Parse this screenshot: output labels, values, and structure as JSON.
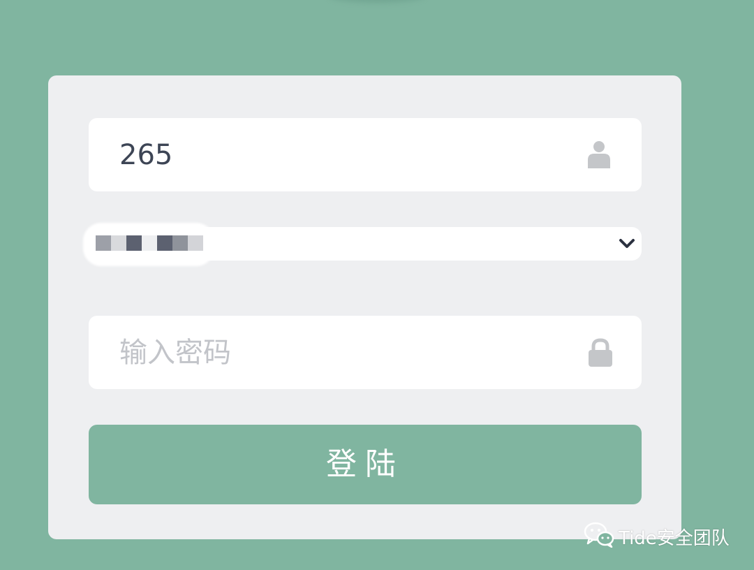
{
  "form": {
    "username_value": "265",
    "password_placeholder": "输入密码",
    "login_label": "登陆"
  },
  "select": {
    "pixel_colors": [
      "#9da0a8",
      "#d9dadd",
      "#5c6170",
      "#eeeff1",
      "#5c6170",
      "#8f939b",
      "#d3d4d8"
    ]
  },
  "icons": {
    "username": "user-icon",
    "select": "chevron-down-icon",
    "password": "lock-icon",
    "watermark": "wechat-icon"
  },
  "watermark": {
    "text": "Tide安全团队"
  },
  "colors": {
    "background": "#80b5a0",
    "card": "#eeeff1",
    "button": "#80b5a0",
    "input_text": "#3d4555",
    "placeholder": "#c2c4c9",
    "icon": "#c4c6c9"
  }
}
